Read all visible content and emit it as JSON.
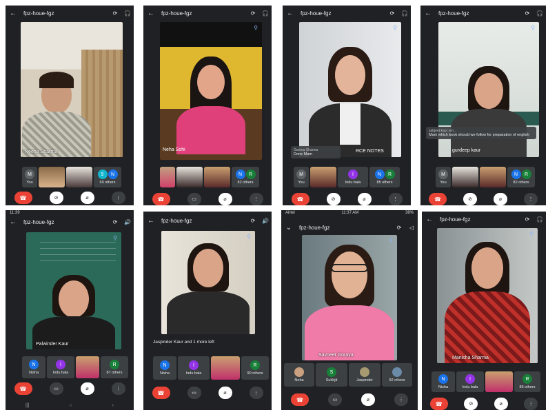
{
  "meeting_code": "fpz-houe-fgz",
  "icons": {
    "back": "back-arrow-icon",
    "dropdown": "caret-right-icon",
    "switch_camera": "switch-camera-icon",
    "audio": "headphones-icon",
    "speaker": "speaker-icon",
    "pin": "pin-icon",
    "end_call": "end-call-icon",
    "camera": "camera-icon",
    "camera_off": "camera-off-icon",
    "mic_off": "mic-off-icon",
    "more": "more-vert-icon"
  },
  "panels": [
    {
      "main_name": "Neena Sharma",
      "strip": [
        {
          "type": "avatar",
          "letter": "M",
          "label": "You",
          "color": "grey"
        },
        {
          "type": "video"
        },
        {
          "type": "video"
        },
        {
          "type": "others",
          "letters": [
            "9",
            "N"
          ],
          "label": "69 others"
        }
      ]
    },
    {
      "main_name": "Neha Sohi",
      "strip": [
        {
          "type": "video"
        },
        {
          "type": "video"
        },
        {
          "type": "video"
        },
        {
          "type": "others",
          "letters": [
            "N",
            "R"
          ],
          "label": "82 others"
        }
      ]
    },
    {
      "main_name": "RCE NOTES",
      "strip": [
        {
          "type": "avatar",
          "letter": "M",
          "label": "You",
          "color": "grey"
        },
        {
          "type": "video"
        },
        {
          "type": "avatar",
          "letter": "I",
          "label": "Indu bala",
          "color": "purple"
        },
        {
          "type": "others",
          "letters": [
            "N",
            "R"
          ],
          "label": "85 others"
        }
      ],
      "chat": {
        "who": "Garima Sharma",
        "text": "Done Mam"
      }
    },
    {
      "main_name": "gurdeep kaur",
      "strip": [
        {
          "type": "avatar",
          "letter": "M",
          "label": "You",
          "color": "grey"
        },
        {
          "type": "video"
        },
        {
          "type": "video"
        },
        {
          "type": "others",
          "letters": [
            "N",
            "R"
          ],
          "label": "82 others"
        }
      ],
      "chat": {
        "who": "sabjeet kaur ren...",
        "text": "Mam which book should we follow for preparation of english"
      }
    },
    {
      "main_name": "Palwinder Kaur",
      "strip": [
        {
          "type": "avatar",
          "letter": "N",
          "label": "Nisha",
          "color": "blue"
        },
        {
          "type": "avatar",
          "letter": "I",
          "label": "Indu bala",
          "color": "purple"
        },
        {
          "type": "video"
        },
        {
          "type": "others",
          "letters": [
            "R"
          ],
          "label": "87 others"
        }
      ],
      "status_time": "11:39"
    },
    {
      "main_name": "",
      "leave_message": "Jaspinder Kaur and 1 more left",
      "strip": [
        {
          "type": "avatar",
          "letter": "N",
          "label": "Nisha",
          "color": "blue"
        },
        {
          "type": "avatar",
          "letter": "I",
          "label": "Indu bala",
          "color": "purple"
        },
        {
          "type": "video"
        },
        {
          "type": "others",
          "letters": [
            "R"
          ],
          "label": "90 others"
        }
      ]
    },
    {
      "main_name": "Savneet Goraya",
      "strip": [
        {
          "type": "video",
          "label": "Neha"
        },
        {
          "type": "avatar",
          "letter": "S",
          "label": "Sukhjit",
          "color": "green"
        },
        {
          "type": "video",
          "label": "Jaspinder"
        },
        {
          "type": "others",
          "letters": [],
          "label": "92 others"
        }
      ],
      "status": {
        "carrier": "Airtel",
        "time": "11:37 AM",
        "battery": "38%"
      }
    },
    {
      "main_name": "Manisha Sharma",
      "strip": [
        {
          "type": "avatar",
          "letter": "N",
          "label": "Nisha",
          "color": "blue"
        },
        {
          "type": "avatar",
          "letter": "I",
          "label": "Indu bala",
          "color": "purple"
        },
        {
          "type": "video"
        },
        {
          "type": "others",
          "letters": [
            "R"
          ],
          "label": "86 others"
        }
      ]
    }
  ]
}
